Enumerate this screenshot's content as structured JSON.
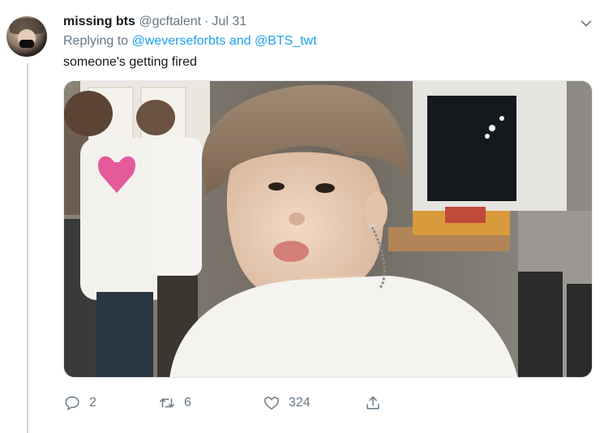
{
  "tweet": {
    "display_name": "missing bts",
    "handle": "@gcftalent",
    "separator": "·",
    "date": "Jul 31",
    "replying_prefix": "Replying to",
    "reply_mention_1": "@weverseforbts",
    "reply_conjunction": "and",
    "reply_mention_2": "@BTS_twt",
    "text": "someone's getting fired"
  },
  "actions": {
    "reply_count": "2",
    "retweet_count": "6",
    "like_count": "324"
  },
  "icons": {
    "reply": "reply-icon",
    "retweet": "retweet-icon",
    "like": "heart-icon",
    "share": "share-icon",
    "menu": "chevron-down-icon"
  },
  "colors": {
    "link": "#1da1f2",
    "secondary_text": "#657786",
    "primary_text": "#14171a",
    "thread_line": "#ccd6dd"
  }
}
